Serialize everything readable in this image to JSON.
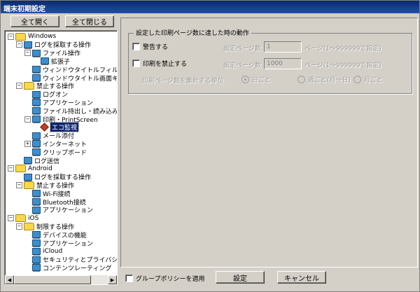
{
  "window": {
    "title": "端末初期設定"
  },
  "toolbar": {
    "expand_all": "全て開く",
    "collapse_all": "全て閉じる"
  },
  "tree": {
    "nodes": [
      {
        "label": "Windows",
        "exp": "−",
        "icon": "folder"
      },
      {
        "label": "ログを採取する操作",
        "exp": "−",
        "icon": "monitor"
      },
      {
        "label": "ファイル操作",
        "exp": "−",
        "icon": "monitor"
      },
      {
        "label": "拡張子",
        "exp": "",
        "icon": "monitor"
      },
      {
        "label": "ウィンドウタイトルフィルタ",
        "exp": "",
        "icon": "monitor"
      },
      {
        "label": "ウィンドウタイトル画面キャ",
        "exp": "",
        "icon": "monitor"
      },
      {
        "label": "禁止する操作",
        "exp": "−",
        "icon": "folder"
      },
      {
        "label": "ログオン",
        "exp": "",
        "icon": "monitor"
      },
      {
        "label": "アプリケーション",
        "exp": "",
        "icon": "monitor"
      },
      {
        "label": "ファイル持出し・読み込み",
        "exp": "",
        "icon": "monitor"
      },
      {
        "label": "印刷・PrintScreen",
        "exp": "−",
        "icon": "monitor"
      },
      {
        "label": "エコ監視",
        "exp": "",
        "icon": "diamond",
        "selected": true
      },
      {
        "label": "メール添付",
        "exp": "",
        "icon": "monitor"
      },
      {
        "label": "インターネット",
        "exp": "+",
        "icon": "monitor"
      },
      {
        "label": "クリップボード",
        "exp": "",
        "icon": "monitor"
      },
      {
        "label": "ログ送信",
        "exp": "",
        "icon": "monitor"
      },
      {
        "label": "Android",
        "exp": "−",
        "icon": "folder"
      },
      {
        "label": "ログを採取する操作",
        "exp": "",
        "icon": "monitor"
      },
      {
        "label": "禁止する操作",
        "exp": "−",
        "icon": "folder"
      },
      {
        "label": "Wi-Fi接続",
        "exp": "",
        "icon": "monitor"
      },
      {
        "label": "Bluetooth接続",
        "exp": "",
        "icon": "monitor"
      },
      {
        "label": "アプリケーション",
        "exp": "",
        "icon": "monitor"
      },
      {
        "label": "iOS",
        "exp": "−",
        "icon": "folder"
      },
      {
        "label": "制限する操作",
        "exp": "−",
        "icon": "folder"
      },
      {
        "label": "デバイスの機能",
        "exp": "",
        "icon": "monitor"
      },
      {
        "label": "アプリケーション",
        "exp": "",
        "icon": "monitor"
      },
      {
        "label": "iCloud",
        "exp": "",
        "icon": "monitor"
      },
      {
        "label": "セキュリティとプライバシー",
        "exp": "",
        "icon": "monitor"
      },
      {
        "label": "コンテンツレーティング",
        "exp": "",
        "icon": "monitor"
      }
    ],
    "scroll_left": "◀",
    "scroll_right": "▶"
  },
  "settings": {
    "group_title": "設定した印刷ページ数に達した時の動作",
    "warn_label": "警告する",
    "warn_pages_label": "設定ページ数",
    "warn_pages_value": "1",
    "warn_hint": "ページ(1〜999999で指定)",
    "prohibit_label": "印刷を禁止する",
    "prohibit_pages_label": "設定ページ数",
    "prohibit_pages_value": "1000",
    "prohibit_hint": "ページ(1〜999999で指定)",
    "unit_label": "印刷ページ数を集計する単位",
    "unit_daily": "日ごと",
    "unit_weekly": "週ごと(月〜日)",
    "unit_monthly": "月ごと"
  },
  "footer": {
    "group_policy": "グループポリシーを適用",
    "ok": "設定",
    "cancel": "キャンセル"
  }
}
